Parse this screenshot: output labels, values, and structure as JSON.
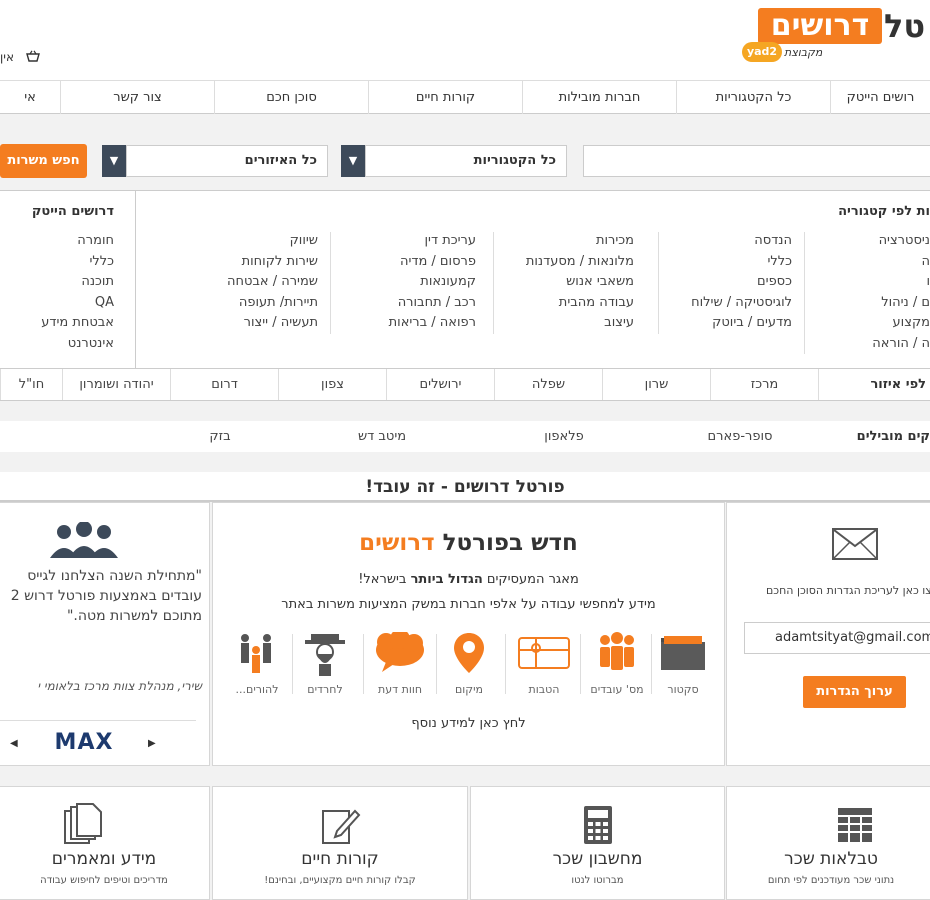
{
  "header": {
    "logo_word": "דרושים",
    "logo_tail": "טל",
    "yad2_badge": "yad2",
    "group_text": "מקבוצת",
    "cart_text": "אין"
  },
  "topnav": [
    {
      "label": "רושים הייטק"
    },
    {
      "label": "כל הקטגוריות"
    },
    {
      "label": "חברות מובילות"
    },
    {
      "label": "קורות חיים"
    },
    {
      "label": "סוכן חכם"
    },
    {
      "label": "צור קשר"
    },
    {
      "label": "אי"
    }
  ],
  "search": {
    "categories_value": "כל הקטגוריות",
    "regions_value": "כל האיזורים",
    "button_label": "חפש משרות"
  },
  "categories": {
    "heading": "ות לפי קטגוריה",
    "columns": [
      [
        "ניסטרציה",
        "ה",
        "ו",
        "ם / ניהול",
        "מקצוע",
        "ה / הוראה"
      ],
      [
        "הנדסה",
        "כללי",
        "כספים",
        "לוגיסטיקה / שילוח",
        "מדעים / ביוטק"
      ],
      [
        "מכירות",
        "מלונאות / מסעדנות",
        "משאבי אנוש",
        "עבודה מהבית",
        "עיצוב"
      ],
      [
        "עריכת דין",
        "פרסום / מדיה",
        "קמעונאות",
        "רכב / תחבורה",
        "רפואה / בריאות"
      ],
      [
        "שיווק",
        "שירות לקוחות",
        "שמירה / אבטחה",
        "תיירות/ תעופה",
        "תעשיה / ייצור"
      ]
    ],
    "hitech_heading": "דרושים הייטק",
    "hitech_items": [
      "חומרה",
      "כללי",
      "תוכנה",
      "QA",
      "אבטחת מידע",
      "אינטרנט"
    ]
  },
  "regions": {
    "heading": "לפי איזור",
    "items": [
      "מרכז",
      "שרון",
      "שפלה",
      "ירושלים",
      "צפון",
      "דרום",
      "יהודה ושומרון",
      "חו\"ל"
    ]
  },
  "leading": {
    "heading": "קים מובילים",
    "items": [
      "סופר-פארם",
      "פלאפון",
      "מיטב דש",
      "בזק"
    ]
  },
  "portal_title": "פורטל דרושים - זה עובד!",
  "mail_card": {
    "text": "צו כאן לעריכת הגדרות הסוכן החכם",
    "email": "adamtsityat@gmail.com",
    "button": "ערוך הגדרות"
  },
  "new_card": {
    "title_prefix": "חדש בפורטל",
    "title_brand": "דרושים",
    "line1_a": "מאגר המעסיקים ",
    "line1_b": "הגדול ביותר",
    "line1_c": " בישראל!",
    "line2": "מידע למחפשי עבודה על אלפי חברות במשק המציעות משרות באתר",
    "features": [
      {
        "label": "סקטור",
        "icon": "folder-icon"
      },
      {
        "label": "מס' עובדים",
        "icon": "people-icon"
      },
      {
        "label": "הטבות",
        "icon": "gift-card-icon"
      },
      {
        "label": "מיקום",
        "icon": "location-pin-icon"
      },
      {
        "label": "חוות דעת",
        "icon": "speech-cloud-icon"
      },
      {
        "label": "לחרדים",
        "icon": "orthodox-man-icon"
      },
      {
        "label": "להורים...",
        "icon": "family-icon"
      }
    ],
    "more_info": "לחץ כאן למידע נוסף"
  },
  "testimonial": {
    "quote": "\"מתחילת השנה הצלחנו לגייס עובדים באמצעות פורטל דרוש 2 מתוכם למשרות מטה.\"",
    "author": "שירי, מנהלת צוות מרכז בלאומי י",
    "logo": "MAX"
  },
  "tiles": [
    {
      "title": "טבלאות שכר",
      "sub": "נתוני שכר מעודכנים לפי תחום",
      "icon": "table-grid-icon"
    },
    {
      "title": "מחשבון שכר",
      "sub": "מברוטו לנטו",
      "icon": "calculator-icon"
    },
    {
      "title": "קורות חיים",
      "sub": "קבלו קורות חיים מקצועיים, ובחינם!",
      "icon": "edit-document-icon"
    },
    {
      "title": "מידע ומאמרים",
      "sub": "מדריכים וטיפים לחיפוש עבודה",
      "icon": "documents-icon"
    }
  ],
  "colors": {
    "accent": "#f47d20",
    "dark_select": "#3d4a5a",
    "max_blue": "#1d3a6e"
  }
}
